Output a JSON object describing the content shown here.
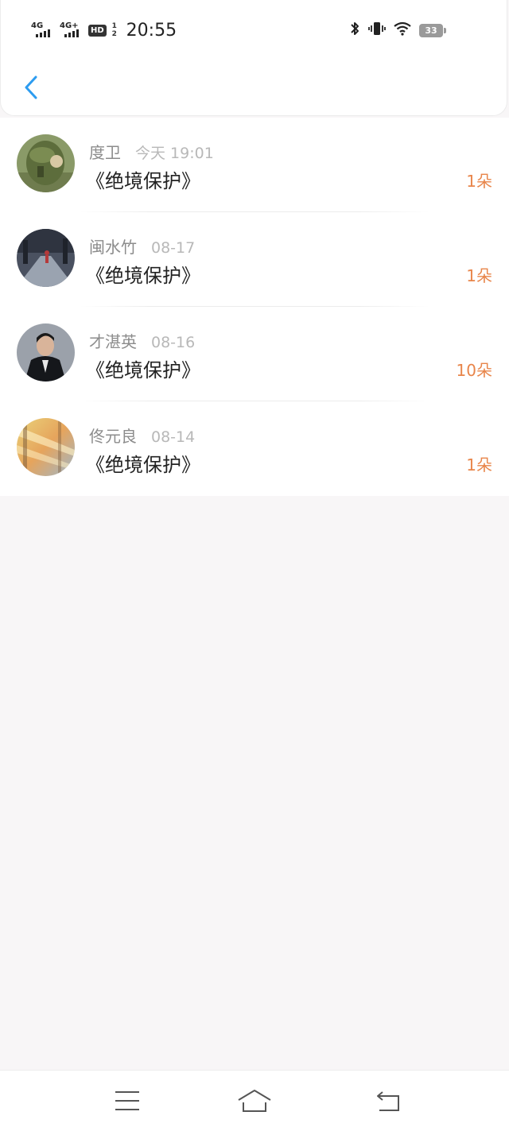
{
  "status_bar": {
    "network_1": "4G",
    "network_2": "4G+",
    "hd_label": "HD",
    "hd_sup": "1 2",
    "time": "20:55",
    "battery": "33"
  },
  "header": {
    "back_icon": "chevron-left-icon"
  },
  "records": [
    {
      "name": "度卫",
      "date": "今天 19:01",
      "book": "《绝境保护》",
      "amount": "1朵",
      "avatar_icon": "avatar-bag"
    },
    {
      "name": "闽水竹",
      "date": "08-17",
      "book": "《绝境保护》",
      "amount": "1朵",
      "avatar_icon": "avatar-runner"
    },
    {
      "name": "才湛英",
      "date": "08-16",
      "book": "《绝境保护》",
      "amount": "10朵",
      "avatar_icon": "avatar-man-suit"
    },
    {
      "name": "佟元良",
      "date": "08-14",
      "book": "《绝境保护》",
      "amount": "1朵",
      "avatar_icon": "avatar-sunlight"
    }
  ],
  "nav": {
    "menu_icon": "menu-icon",
    "home_icon": "home-icon",
    "back_icon": "back-icon"
  },
  "colors": {
    "accent_blue": "#2d9cf0",
    "amount_orange": "#e8854a",
    "background": "#f8f6f7"
  }
}
